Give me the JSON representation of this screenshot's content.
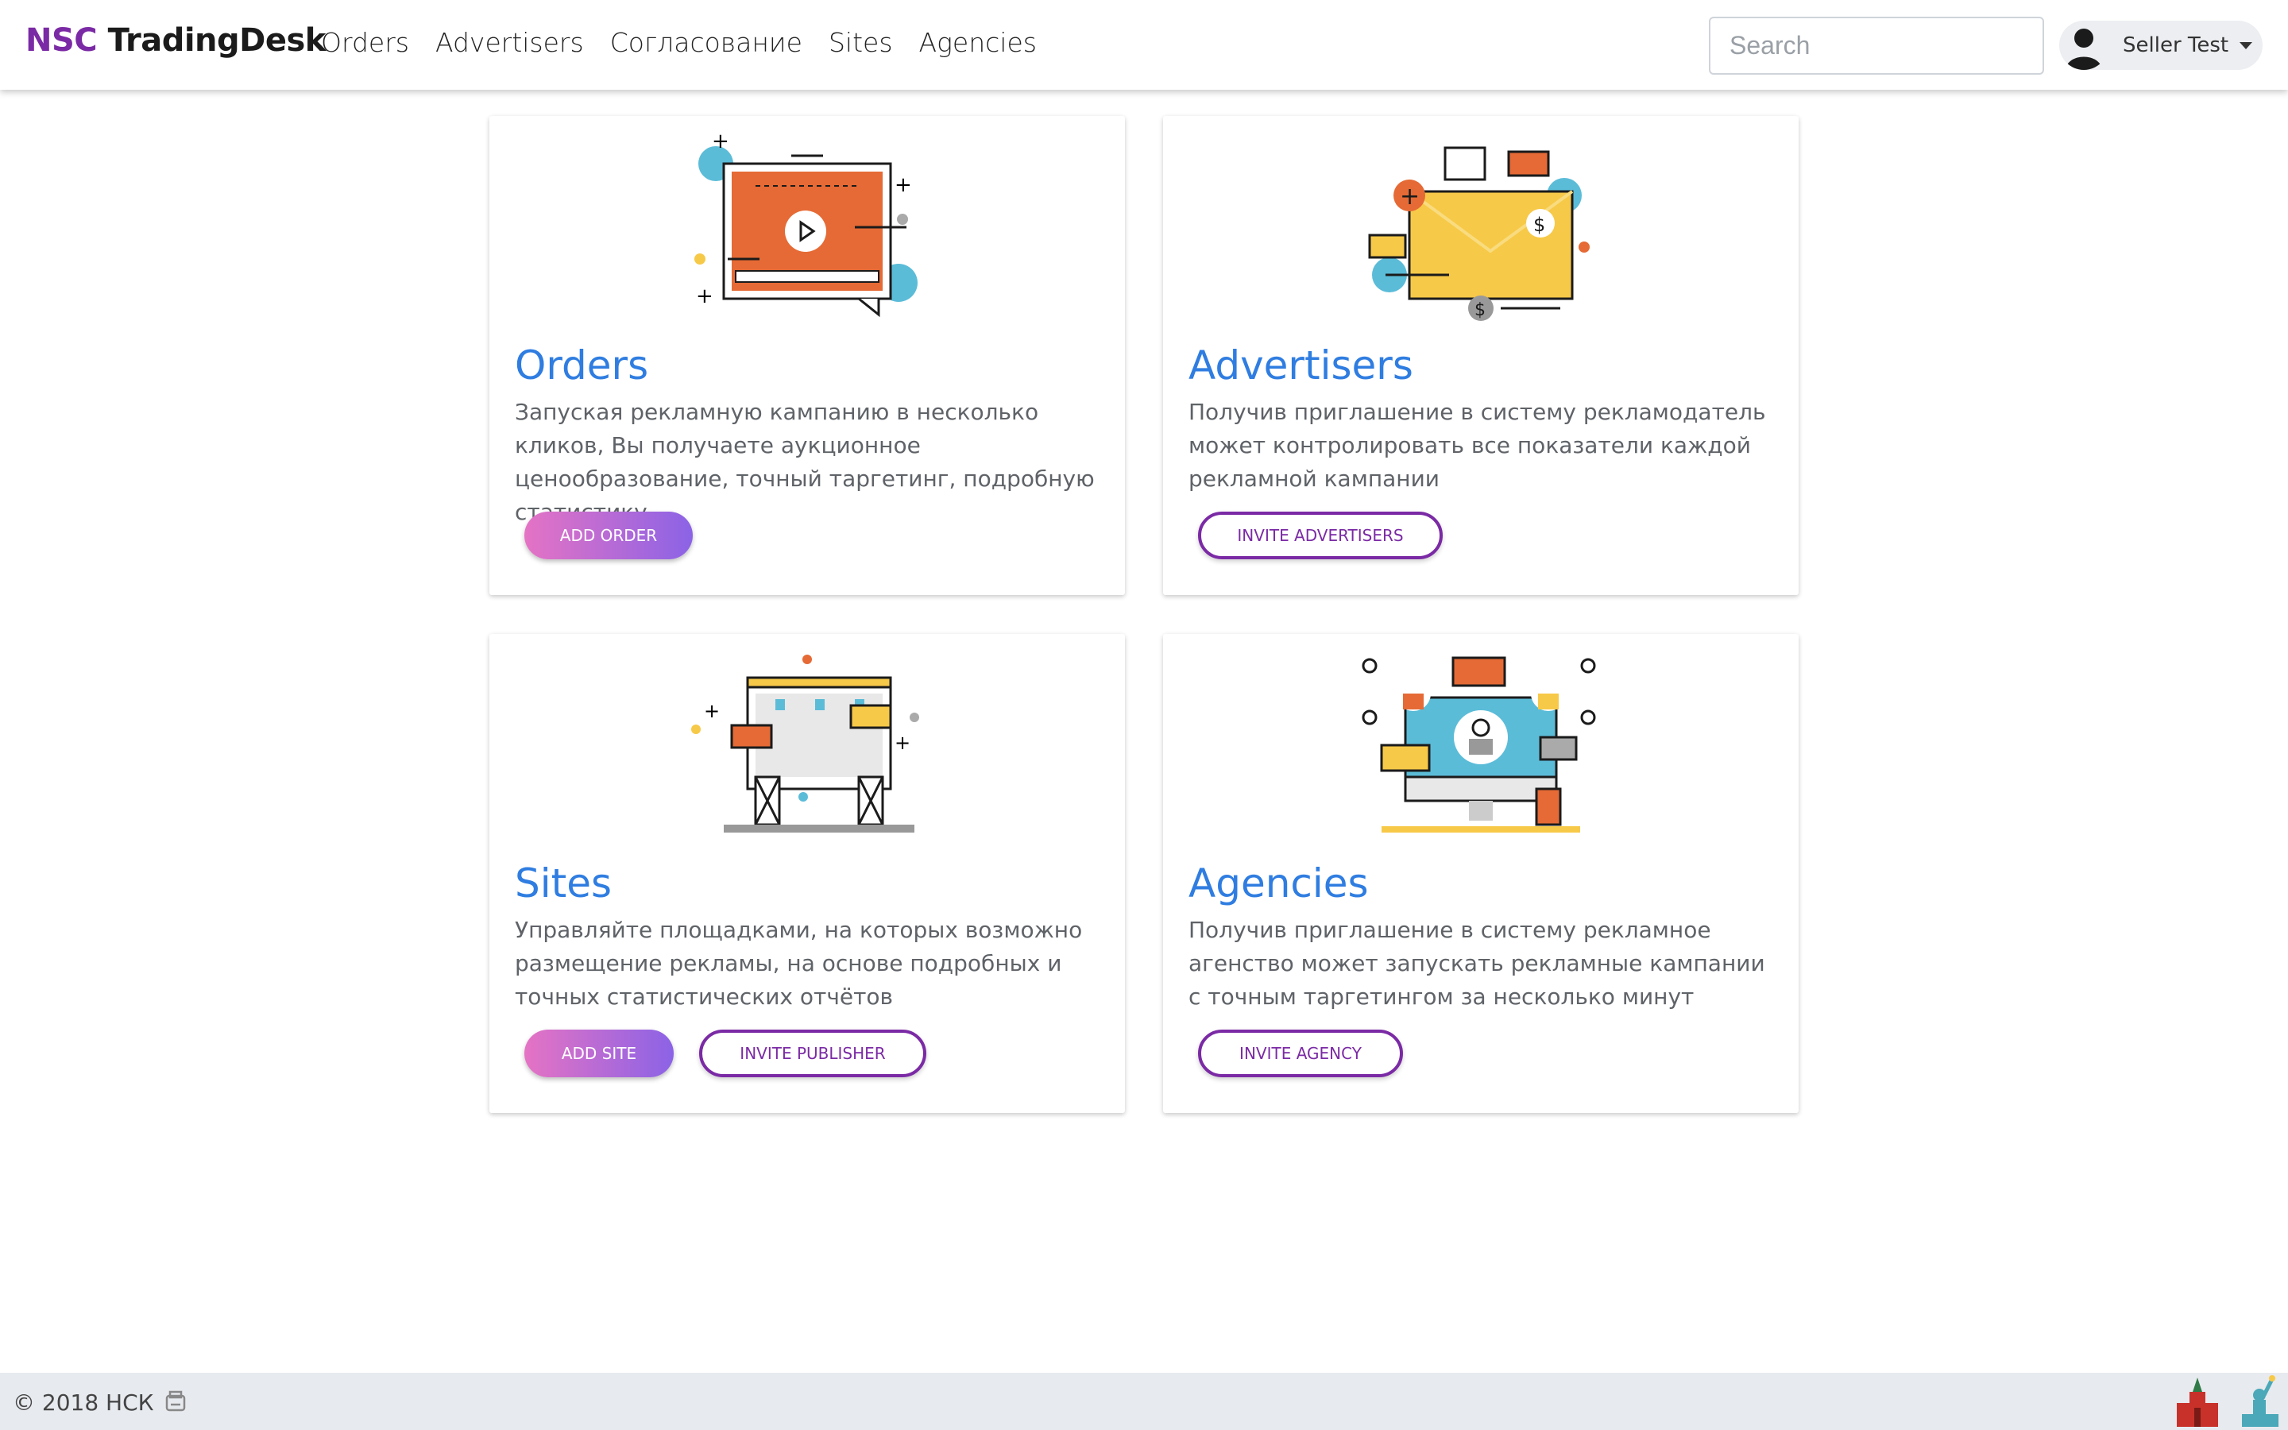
{
  "brand": {
    "prefix": "NSC",
    "name": "TradingDesk"
  },
  "nav": [
    "Orders",
    "Advertisers",
    "Согласование",
    "Sites",
    "Agencies"
  ],
  "search": {
    "placeholder": "Search",
    "value": ""
  },
  "user": {
    "name": "Seller Test"
  },
  "cards": [
    {
      "title": "Orders",
      "description": "Запуская рекламную кампанию в несколько кликов, Вы получаете аукционное ценообразование, точный таргетинг, подробную статистику",
      "buttons": [
        "ADD ORDER"
      ]
    },
    {
      "title": "Advertisers",
      "description": "Получив приглашение в систему рекламодатель может контролировать все показатели каждой рекламной кампании",
      "buttons": [
        "INVITE ADVERTISERS"
      ]
    },
    {
      "title": "Sites",
      "description": "Управляйте площадками, на которых возможно размещение рекламы, на основе подробных и точных статистических отчётов",
      "buttons": [
        "ADD SITE",
        "INVITE PUBLISHER"
      ]
    },
    {
      "title": "Agencies",
      "description": "Получив приглашение в систему рекламное агенство может запускать рекламные кампании с точным таргетингом за несколько минут",
      "buttons": [
        "INVITE AGENCY"
      ]
    }
  ],
  "footer": {
    "copyright": "© 2018 НСК"
  },
  "colors": {
    "brand_purple": "#7b2aa5",
    "title_blue": "#2f7de1",
    "gradient_start": "#e573c4",
    "gradient_end": "#8b63e6"
  }
}
